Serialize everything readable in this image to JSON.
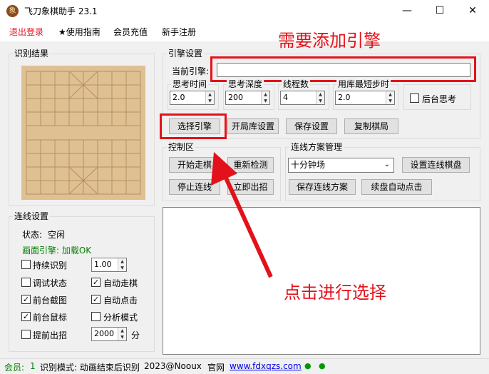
{
  "window": {
    "title": "飞刀象棋助手 23.1",
    "icon_label": "象"
  },
  "menu": [
    {
      "label": "退出登录",
      "color": "#e81123"
    },
    {
      "label": "★使用指南"
    },
    {
      "label": "会员充值"
    },
    {
      "label": "新手注册"
    }
  ],
  "recognition": {
    "title": "识别结果"
  },
  "engine": {
    "title": "引擎设置",
    "current_label": "当前引擎:",
    "current_value": "",
    "think_time_label": "思考时间",
    "think_time": "2.0",
    "think_depth_label": "思考深度",
    "think_depth": "200",
    "threads_label": "线程数",
    "threads": "4",
    "lib_steps_label": "用库最短步时",
    "lib_steps": "2.0",
    "bg_think_label": "后台思考",
    "select_btn": "选择引擎",
    "opening_btn": "开局库设置",
    "save_btn": "保存设置",
    "copy_btn": "复制棋局"
  },
  "control": {
    "title": "控制区",
    "start_btn": "开始走棋",
    "recheck_btn": "重新检测",
    "stop_btn": "停止连线",
    "instant_btn": "立即出招"
  },
  "plan": {
    "title": "连线方案管理",
    "selected": "十分钟场",
    "set_board_btn": "设置连线棋盘",
    "save_plan_btn": "保存连线方案",
    "auto_click_btn": "续盘自动点击"
  },
  "connect": {
    "title": "连线设置",
    "state_label": "状态:",
    "state_value": "空闲",
    "engine_status": "画面引擎: 加载OK",
    "engine_status_color": "#008000",
    "continuous_label": "持续识别",
    "continuous_value": "1.00",
    "debug_label": "调试状态",
    "auto_move_label": "自动走棋",
    "fg_capture_label": "前台截图",
    "auto_click_label": "自动点击",
    "fg_mouse_label": "前台鼠标",
    "analysis_label": "分析模式",
    "early_label": "提前出招",
    "early_value": "2000",
    "early_unit": "分"
  },
  "annotations": {
    "top": "需要添加引擎",
    "bottom": "点击进行选择",
    "color": "#e3121a"
  },
  "status_bar": {
    "member_label": "会员:",
    "member_value": "1",
    "mode": "识别模式: 动画结束后识别",
    "copyright": "2023@Nooux",
    "site_label": "官网",
    "site_url": "www.fdxqzs.com",
    "dot_color": "#009900"
  }
}
